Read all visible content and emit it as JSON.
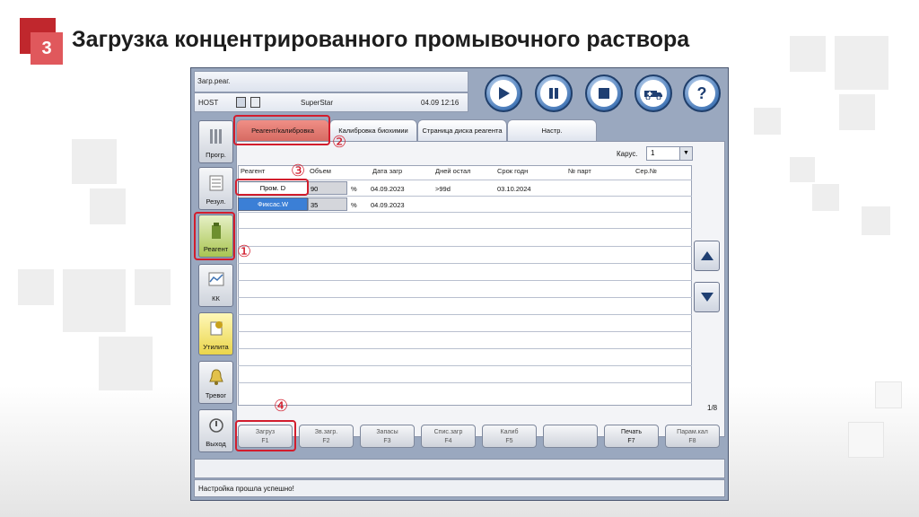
{
  "slide": {
    "number": "3",
    "title": "Загрузка концентрированного промывочного раствора"
  },
  "app": {
    "window_title": "Загр.реаг.",
    "host_label": "HOST",
    "system_name": "SuperStar",
    "datetime": "04.09 12:16",
    "sidebar": [
      {
        "label": "Прогр."
      },
      {
        "label": "Резул."
      },
      {
        "label": "Реагент"
      },
      {
        "label": "КК"
      },
      {
        "label": "Утилита"
      },
      {
        "label": "Тревог"
      },
      {
        "label": "Выход"
      }
    ],
    "tabs": [
      {
        "label": "Реагент/калибровка"
      },
      {
        "label": "Калибровка биохимии"
      },
      {
        "label": "Страница диска реагента"
      },
      {
        "label": "Настр."
      }
    ],
    "carousel_label": "Карус.",
    "carousel_value": "1",
    "columns": [
      "Реагент",
      "Объем",
      "Дата загр",
      "Дней остал",
      "Срок годн",
      "№ парт",
      "Сер.№"
    ],
    "rows": [
      {
        "reagent": "Пром. D",
        "volume": "90",
        "unit": "%",
        "load_date": "04.09.2023",
        "days_left": ">99d",
        "expiry": "03.10.2024"
      },
      {
        "reagent": "Фиксас.W",
        "volume": "35",
        "unit": "%",
        "load_date": "04.09.2023",
        "days_left": "",
        "expiry": ""
      }
    ],
    "page_indicator": "1/8",
    "function_buttons": [
      {
        "label": "Загруз",
        "key": "F1"
      },
      {
        "label": "Зв.загр.",
        "key": "F2"
      },
      {
        "label": "Запасы",
        "key": "F3"
      },
      {
        "label": "Спис.загр",
        "key": "F4"
      },
      {
        "label": "Калиб",
        "key": "F5"
      },
      {
        "label": "",
        "key": ""
      },
      {
        "label": "Печать",
        "key": "F7"
      },
      {
        "label": "Парам.кал",
        "key": "F8"
      }
    ],
    "status_message": "Настройка прошла успешно!"
  },
  "callouts": [
    "①",
    "②",
    "③",
    "④"
  ],
  "colors": {
    "accent_red": "#d21d2d",
    "slide_red": "#c0272d",
    "tab_active": "#e07a72",
    "button_blue": "#3f73b4"
  },
  "icons": [
    "play-icon",
    "pause-icon",
    "stop-icon",
    "ambulance-icon",
    "help-icon"
  ]
}
